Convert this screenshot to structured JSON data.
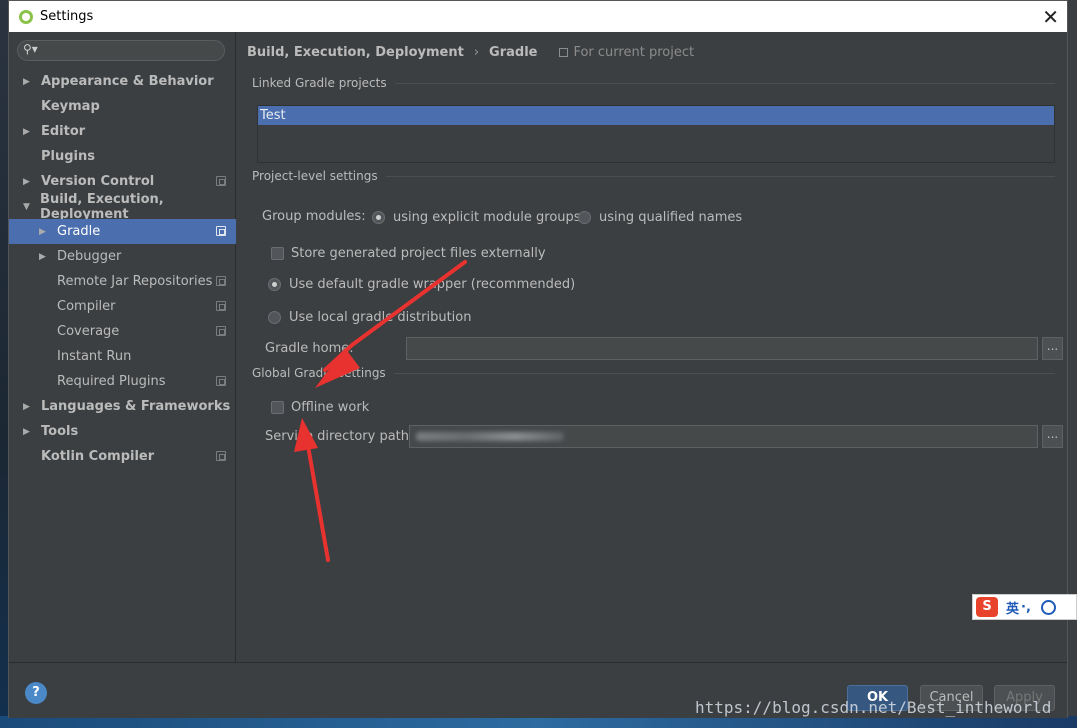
{
  "window": {
    "title": "Settings",
    "close_glyph": "✕"
  },
  "search": {
    "placeholder": "",
    "icon": "search-icon"
  },
  "sidebar": {
    "items": [
      {
        "label": "Appearance & Behavior",
        "level": 1,
        "expandable": true,
        "project": false
      },
      {
        "label": "Keymap",
        "level": 1,
        "expandable": false,
        "project": false
      },
      {
        "label": "Editor",
        "level": 1,
        "expandable": true,
        "project": false
      },
      {
        "label": "Plugins",
        "level": 1,
        "expandable": false,
        "project": false
      },
      {
        "label": "Version Control",
        "level": 1,
        "expandable": true,
        "project": true
      },
      {
        "label": "Build, Execution, Deployment",
        "level": 1,
        "expanded": true,
        "project": false
      },
      {
        "label": "Gradle",
        "level": 2,
        "expandable": true,
        "project": true,
        "selected": true
      },
      {
        "label": "Debugger",
        "level": 2,
        "expandable": true,
        "project": false
      },
      {
        "label": "Remote Jar Repositories",
        "level": 2,
        "expandable": false,
        "project": true
      },
      {
        "label": "Compiler",
        "level": 2,
        "expandable": false,
        "project": true
      },
      {
        "label": "Coverage",
        "level": 2,
        "expandable": false,
        "project": true
      },
      {
        "label": "Instant Run",
        "level": 2,
        "expandable": false,
        "project": false
      },
      {
        "label": "Required Plugins",
        "level": 2,
        "expandable": false,
        "project": true
      },
      {
        "label": "Languages & Frameworks",
        "level": 1,
        "expandable": true,
        "project": false
      },
      {
        "label": "Tools",
        "level": 1,
        "expandable": true,
        "project": false
      },
      {
        "label": "Kotlin Compiler",
        "level": 1,
        "expandable": false,
        "project": true
      }
    ]
  },
  "breadcrumb": {
    "parent": "Build, Execution, Deployment",
    "separator": "›",
    "current": "Gradle",
    "scope": "For current project"
  },
  "linked": {
    "section": "Linked Gradle projects",
    "projects": [
      "Test"
    ]
  },
  "project_level": {
    "section": "Project-level settings",
    "group_modules_label": "Group modules:",
    "option_explicit": "using explicit module groups",
    "option_qualified": "using qualified names",
    "store_external": "Store generated project files externally",
    "use_wrapper": "Use default gradle wrapper (recommended)",
    "use_local": "Use local gradle distribution",
    "gradle_home_label": "Gradle home:",
    "gradle_home_value": ""
  },
  "global": {
    "section": "Global Gradle settings",
    "offline_work": "Offline work",
    "service_dir_label": "Service directory path:",
    "browse": "..."
  },
  "footer": {
    "help": "?",
    "ok": "OK",
    "cancel": "Cancel",
    "apply": "Apply"
  },
  "watermark": "https://blog.csdn.net/Best_intheworld",
  "ime": {
    "logo": "S",
    "text": "英 ",
    "punct": "·,"
  },
  "colors": {
    "accent": "#4b6eaf",
    "annotation": "#e8322f",
    "ok_button": "#365880"
  }
}
